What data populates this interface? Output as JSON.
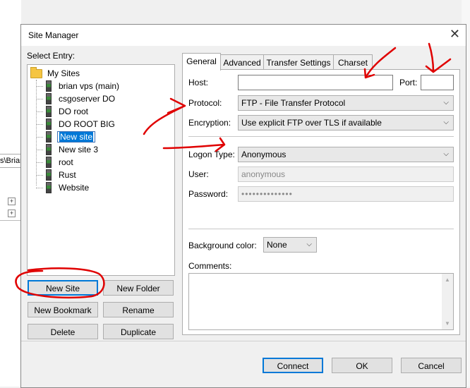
{
  "background": {
    "path_text": "s\\Brian"
  },
  "dialog": {
    "title": "Site Manager",
    "select_entry_label": "Select Entry:",
    "tree": {
      "root": "My Sites",
      "items": [
        {
          "label": "brian vps (main)"
        },
        {
          "label": "csgoserver DO"
        },
        {
          "label": "DO root"
        },
        {
          "label": "DO ROOT BIG"
        },
        {
          "label": "New site",
          "selected": true
        },
        {
          "label": "New site 3"
        },
        {
          "label": "root"
        },
        {
          "label": "Rust"
        },
        {
          "label": "Website"
        }
      ]
    },
    "left_buttons": {
      "new_site": "New Site",
      "new_folder": "New Folder",
      "new_bookmark": "New Bookmark",
      "rename": "Rename",
      "delete": "Delete",
      "duplicate": "Duplicate"
    },
    "tabs": [
      "General",
      "Advanced",
      "Transfer Settings",
      "Charset"
    ],
    "general": {
      "host_label": "Host:",
      "host_value": "",
      "port_label": "Port:",
      "port_value": "",
      "protocol_label": "Protocol:",
      "protocol_value": "FTP - File Transfer Protocol",
      "encryption_label": "Encryption:",
      "encryption_value": "Use explicit FTP over TLS if available",
      "logon_type_label": "Logon Type:",
      "logon_type_value": "Anonymous",
      "user_label": "User:",
      "user_value": "anonymous",
      "password_label": "Password:",
      "password_value": "••••••••••••••",
      "background_color_label": "Background color:",
      "background_color_value": "None",
      "comments_label": "Comments:"
    },
    "footer": {
      "connect": "Connect",
      "ok": "OK",
      "cancel": "Cancel"
    }
  },
  "annotation_color": "#e00000",
  "icons": {
    "close": "close-icon",
    "folder": "folder-icon",
    "server": "server-icon",
    "dropdown": "chevron-down-icon"
  }
}
